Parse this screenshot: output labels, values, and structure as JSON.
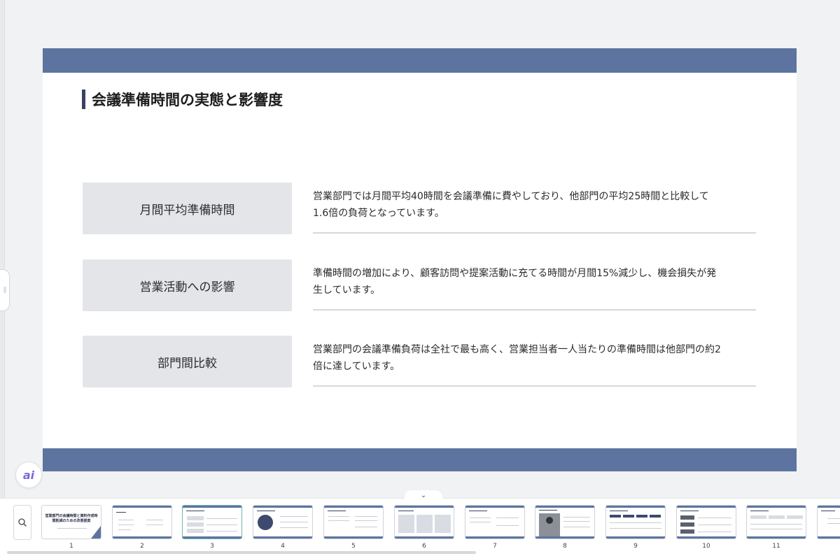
{
  "slide": {
    "title": "会議準備時間の実態と影響度",
    "rows": [
      {
        "label": "月間平均準備時間",
        "desc_line1": "営業部門では月間平均40時間を会議準備に費やしており、他部門の平均25時間と比較して",
        "desc_line2": "1.6倍の負荷となっています。"
      },
      {
        "label": "営業活動への影響",
        "desc_line1": "準備時間の増加により、顧客訪問や提案活動に充てる時間が月間15%減少し、機会損失が発",
        "desc_line2": "生しています。"
      },
      {
        "label": "部門間比較",
        "desc_line1": "営業部門の会議準備負荷は全社で最も高く、営業担当者一人当たりの準備時間は他部門の約2",
        "desc_line2": "倍に達しています。"
      }
    ]
  },
  "ai_button": {
    "label": "ai"
  },
  "filmstrip": {
    "cover_title": "営業部門の会議時間と資料作成時間削減のための改善提案",
    "active_slide": 3,
    "thumbs": [
      {
        "num": "1"
      },
      {
        "num": "2"
      },
      {
        "num": "3"
      },
      {
        "num": "4"
      },
      {
        "num": "5"
      },
      {
        "num": "6"
      },
      {
        "num": "7"
      },
      {
        "num": "8"
      },
      {
        "num": "9"
      },
      {
        "num": "10"
      },
      {
        "num": "11"
      }
    ]
  },
  "icons": {
    "zoom": "zoom-search-icon",
    "collapse": "chevron-down-icon",
    "handle": "drag-handle-icon"
  },
  "colors": {
    "band": "#5e74a0",
    "active_border": "#6cb7b0",
    "label_bg": "#e4e5e9"
  }
}
